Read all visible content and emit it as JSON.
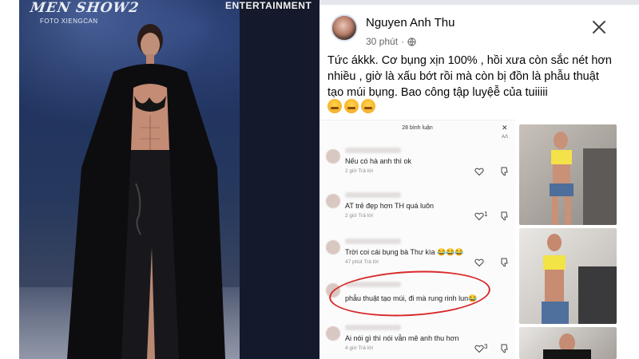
{
  "runway": {
    "logo_text": "MEN SHOW2",
    "photo_credit": "FOTO XIENGCAN",
    "entertainment_text": "ENTERTAINMENT"
  },
  "post": {
    "poster_name": "Nguyen Anh Thu",
    "time": "30 phút",
    "text": "Tức ákkk. Cơ bụng xịn 100% , hồi xưa còn sắc nét hơn nhiều , giờ là xấu bớt rồi mà còn bị đồn là phẫu thuật tạo múi bụng. Bao công tập luyệễ của tuiiiii",
    "emoji_icons": [
      "angry-face-icon",
      "angry-face-icon",
      "angry-face-icon"
    ]
  },
  "comments_screenshot": {
    "header": "28 bình luận",
    "aa_label": "AΛ",
    "comments": [
      {
        "text": "Nếu có hà anh thì ok",
        "meta": "2 giờ    Trả lời",
        "likes": ""
      },
      {
        "text": "AT trẻ đẹp hơn TH quá luôn",
        "meta": "2 giờ    Trả lời",
        "likes": "1"
      },
      {
        "text": "Trời coi cái bụng bà Thư kìa 😂😂😂",
        "meta": "47 phút    Trả lời",
        "likes": ""
      },
      {
        "text": "phẫu thuật tạo múi, đi mà rung rinh lun😂",
        "meta": "",
        "likes": ""
      },
      {
        "text": "Ai nói gì thì nói vẫn mê anh thu hơn",
        "meta": "4 giờ    Trả lời",
        "likes": "3"
      }
    ]
  },
  "colors": {
    "facebook_text": "#050505",
    "meta_gray": "#65676b",
    "highlight_red": "#d9292a",
    "runway_blue": "#1a2b55"
  }
}
